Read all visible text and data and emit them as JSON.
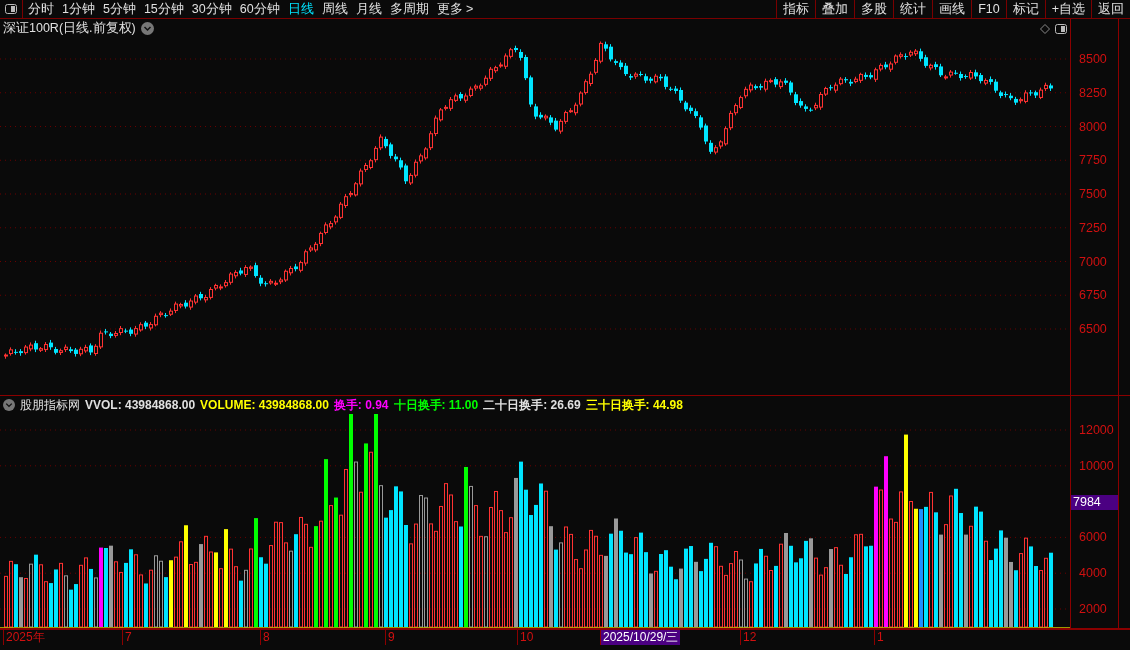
{
  "toolbar": {
    "periods": [
      {
        "label": "分时",
        "selected": false
      },
      {
        "label": "1分钟",
        "selected": false
      },
      {
        "label": "5分钟",
        "selected": false
      },
      {
        "label": "15分钟",
        "selected": false
      },
      {
        "label": "30分钟",
        "selected": false
      },
      {
        "label": "60分钟",
        "selected": false
      },
      {
        "label": "日线",
        "selected": true
      },
      {
        "label": "周线",
        "selected": false
      },
      {
        "label": "月线",
        "selected": false
      },
      {
        "label": "多周期",
        "selected": false
      },
      {
        "label": "更多 >",
        "selected": false
      }
    ],
    "actions": [
      "指标",
      "叠加",
      "多股",
      "统计",
      "画线",
      "F10",
      "标记",
      "+自选",
      "返回"
    ]
  },
  "price_panel": {
    "title": "深证100R(日线.前复权)",
    "y_axis_labels": [
      "8500",
      "8250",
      "8000",
      "7750",
      "7500",
      "7250",
      "7000",
      "6750",
      "6500"
    ]
  },
  "volume_panel": {
    "indicator_name": "股朋指标网",
    "readings": [
      {
        "text": "VVOL: 43984868.00",
        "color": "#e0e0e0"
      },
      {
        "text": "VOLUME: 43984868.00",
        "color": "#ffff00"
      },
      {
        "text": "换手: 0.94",
        "color": "#ff00ff"
      },
      {
        "text": "十日换手: 11.00",
        "color": "#00ff00"
      },
      {
        "text": "二十日换手: 26.69",
        "color": "#e0e0e0"
      },
      {
        "text": "三十日换手: 44.98",
        "color": "#ffff00"
      }
    ],
    "y_axis_labels": [
      "12000",
      "10000",
      "6000",
      "4000",
      "2000"
    ],
    "cursor_value": "7984"
  },
  "date_axis": {
    "labels": [
      {
        "text": "2025年",
        "selected": false
      },
      {
        "text": "7",
        "selected": false
      },
      {
        "text": "8",
        "selected": false
      },
      {
        "text": "9",
        "selected": false
      },
      {
        "text": "10",
        "selected": false
      },
      {
        "text": "2025/10/29/三",
        "selected": true
      },
      {
        "text": "12",
        "selected": false
      },
      {
        "text": "1",
        "selected": false
      }
    ]
  }
}
